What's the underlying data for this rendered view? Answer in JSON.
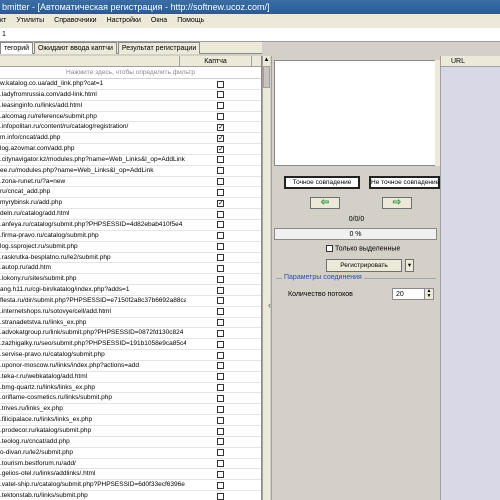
{
  "window": {
    "title": "bmitter - [Автоматическая регистрация - http://softnew.ucoz.com/]"
  },
  "menu": [
    "кт",
    "Утилиты",
    "Справочники",
    "Настройки",
    "Окна",
    "Помощь"
  ],
  "address": "1",
  "tabs": [
    {
      "label": "тегорий",
      "active": true
    },
    {
      "label": "Ожидают ввода каптчи",
      "active": false
    },
    {
      "label": "Результат регистрации",
      "active": false
    }
  ],
  "grid": {
    "col_captcha": "Каптча",
    "filter_hint": "Нажмите здесь, чтобы определить фильтр",
    "rows": [
      {
        "url": "w.katalog.co.ua/add_link.php?cat=1",
        "checked": false
      },
      {
        "url": ".ladyfromrussia.com/add-link.html",
        "checked": false
      },
      {
        "url": ".leasinginfo.ru/links/add.html",
        "checked": false
      },
      {
        "url": ".alcomag.ru/reference/submit.php",
        "checked": false
      },
      {
        "url": ".infopolitan.ru/content/ru/catalog/registration/",
        "checked": true
      },
      {
        "url": "m.info/cncat/add.php",
        "checked": true
      },
      {
        "url": "log.azovmar.com/add.php",
        "checked": true
      },
      {
        "url": ".citynavigator.kz/modules.php?name=Web_Links&l_op=AddLink",
        "checked": false
      },
      {
        "url": "ee.ru/modules.php?name=Web_Links&l_op=AddLink",
        "checked": false
      },
      {
        "url": ".zona-runet.ru/?a=new",
        "checked": false
      },
      {
        "url": "ru/cncat_add.php",
        "checked": false
      },
      {
        "url": "myrybinsk.ru/add.php",
        "checked": true
      },
      {
        "url": "deln.ru/catalog/add.html",
        "checked": false
      },
      {
        "url": ".anfeya.ru/catalog/submit.php?PHPSESSID=4d82ebab410f5e4",
        "checked": false
      },
      {
        "url": ".firma-pravo.ru/catalog/submit.php",
        "checked": false
      },
      {
        "url": "log.ssproject.ru/submit.php",
        "checked": false
      },
      {
        "url": ".raskrutka-besplatno.ru/le2/submit.php",
        "checked": false
      },
      {
        "url": ".autop.ru/add.htm",
        "checked": false
      },
      {
        "url": ".lokony.ru/sites/submit.php",
        "checked": false
      },
      {
        "url": "ang.h11.ru/cgi-bin/katalog/index.php?adds=1",
        "checked": false
      },
      {
        "url": "flesta.ru/dir/submit.php?PHPSESSID=e7150f2a8c37b6692a88ca",
        "checked": false
      },
      {
        "url": ".internetshops.ru/sotovye/cell/add.html",
        "checked": false
      },
      {
        "url": ".stranadetstva.ru/links_ex.php",
        "checked": false
      },
      {
        "url": ".advokatgroup.ru/link/submit.php?PHPSESSID=0872fd130c824",
        "checked": false
      },
      {
        "url": ".zazhigalky.ru/seo/submit.php?PHPSESSID=191b1058e9ca85c4",
        "checked": false
      },
      {
        "url": ".servise-pravo.ru/catalog/submit.php",
        "checked": false
      },
      {
        "url": ".uponor-moscow.ru/links/index.php?actions=add",
        "checked": false
      },
      {
        "url": ".teka-r.ru/webkatalog/add.html",
        "checked": false
      },
      {
        "url": ".bmg-quartz.ru/links/links_ex.php",
        "checked": false
      },
      {
        "url": ".oriflame-cosmetics.ru/links/submit.php",
        "checked": false
      },
      {
        "url": ".trives.ru/links_ex.php",
        "checked": false
      },
      {
        "url": ".filicipalace.ru/links/links_ex.php",
        "checked": false
      },
      {
        "url": ".prodecor.ru/katalog/submit.php",
        "checked": false
      },
      {
        "url": ".teolog.ru/cncat/add.php",
        "checked": false
      },
      {
        "url": "o-divan.ru/le2/submit.php",
        "checked": false
      },
      {
        "url": ".tourism.bestforum.ru/add/",
        "checked": false
      },
      {
        "url": ".gelios-otel.ru/links/addlinks/.html",
        "checked": false
      },
      {
        "url": ".vatel-ship.ru/catalog/submit.php?PHPSESSID=6d0f33ecf6396e",
        "checked": false
      },
      {
        "url": ".tektonstab.ru/links/submit.php",
        "checked": false
      }
    ]
  },
  "right_panel": {
    "exact_match": "Точное совпадение",
    "not_exact_match": "Не точное совпадение",
    "left_arrow": "⇦",
    "right_arrow": "⇨",
    "counter": "0/0/0",
    "progress": "0 %",
    "progress_value": 0,
    "only_selected": "Только выделенные",
    "register": "Регистрировать",
    "dropdown": "▾",
    "conn_params": "Параметры соединения",
    "threads_label": "Количество потоков",
    "threads_value": "20"
  },
  "right_list": {
    "header": "URL"
  },
  "icons": {
    "left-arrow-icon": "green left arrow",
    "right-arrow-icon": "green right arrow",
    "collapse-icon": "‹"
  },
  "colors": {
    "title_bar": "#2a5a96",
    "group_label": "#2a4fa8",
    "arrow": "#2a9d3a"
  }
}
